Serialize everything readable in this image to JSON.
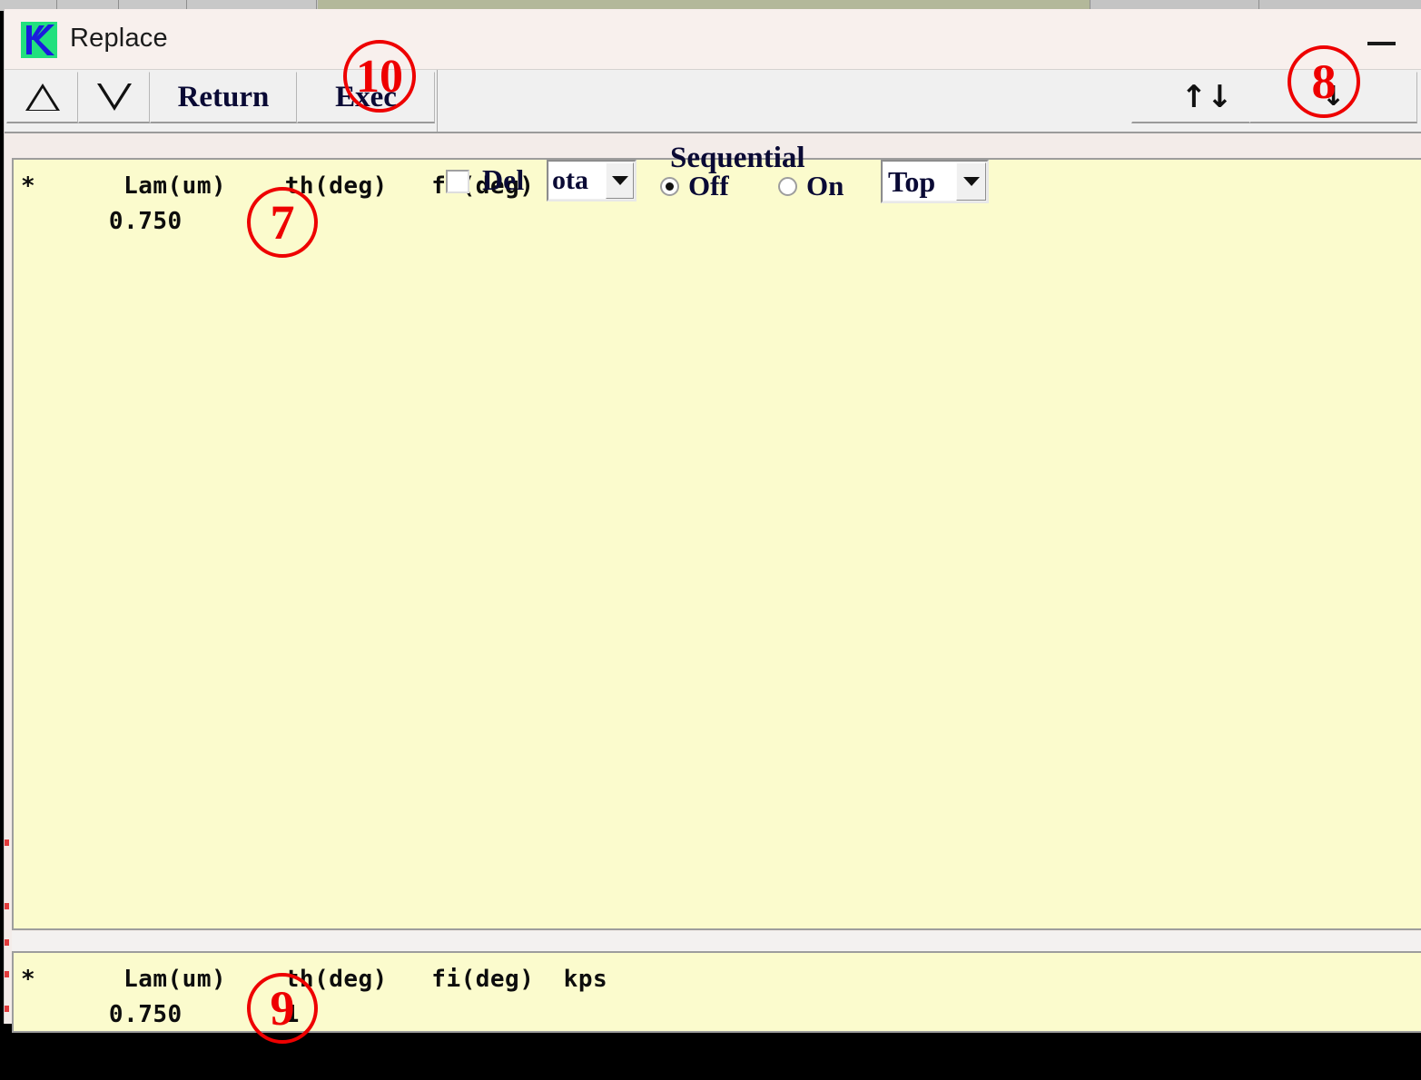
{
  "window": {
    "title": "Replace",
    "icon_name": "kaleido-app-icon",
    "minimize_label": "Minimize"
  },
  "toolbar": {
    "up_button": "△",
    "down_button": "▽",
    "return_button": "Return",
    "exec_button": "Exec",
    "del_label": "Del",
    "del_checked": false,
    "mode_select_value": "ota",
    "sequential_label": "Sequential",
    "sequential_off_label": "Off",
    "sequential_on_label": "On",
    "sequential_selected": "Off",
    "position_select_value": "Top",
    "sort_button_glyph": "↑↓",
    "jump_button_glyph": "↓"
  },
  "main_panel": {
    "header_line": "*      Lam(um)    th(deg)   fi(deg)  kps",
    "data_line": "      0.750"
  },
  "sub_panel": {
    "header_line": "*      Lam(um)    th(deg)   fi(deg)  kps",
    "data_line": "      0.750       1"
  },
  "annotations": [
    {
      "id": "10",
      "label": "10",
      "target": "exec-button"
    },
    {
      "id": "8",
      "label": "8",
      "target": "jump-button"
    },
    {
      "id": "7",
      "label": "7",
      "target": "main-text-panel"
    },
    {
      "id": "9",
      "label": "9",
      "target": "sub-text-panel"
    }
  ],
  "colors": {
    "panel_background": "#fbfbcd",
    "toolbar_background": "#f0f0f0",
    "title_background": "#f8f0ed",
    "annotation_red": "#ee0000",
    "button_text": "#0a0a35"
  }
}
